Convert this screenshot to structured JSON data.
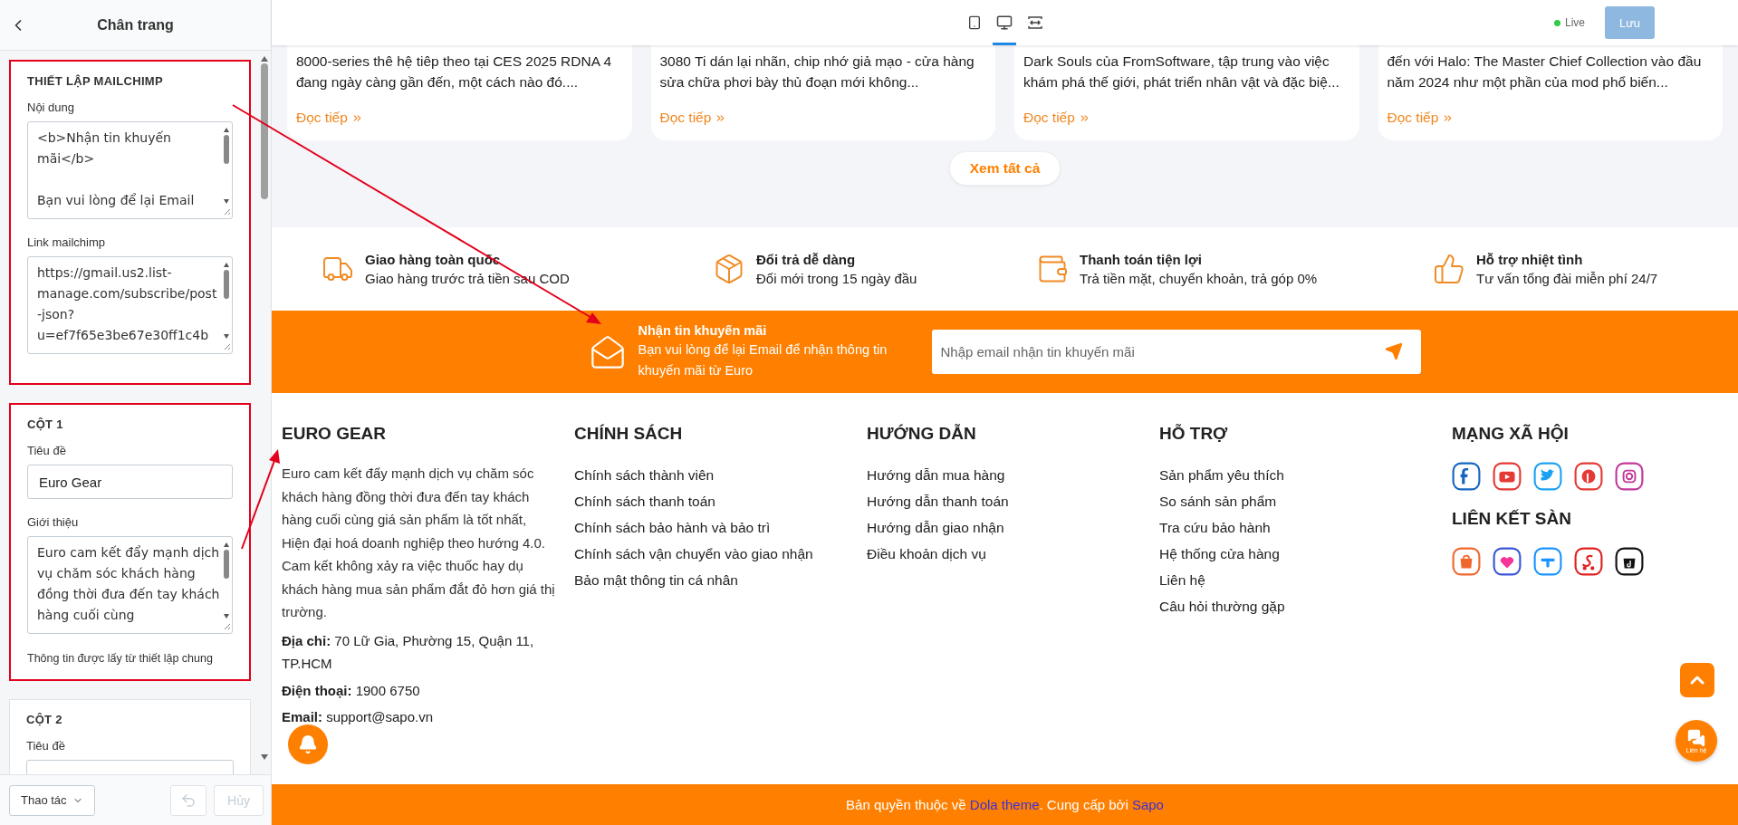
{
  "sidebar": {
    "title": "Chân trang",
    "sections": [
      {
        "heading": "THIẾT LẬP MAILCHIMP",
        "highlighted": true,
        "fields": [
          {
            "kind": "textarea",
            "label": "Nội dung",
            "value": "<b>Nhận tin khuyến mãi</b>\n\nBạn vui lòng để lại Email"
          },
          {
            "kind": "textarea",
            "label": "Link mailchimp",
            "value": "https://gmail.us2.list-manage.com/subscribe/post-json?u=ef7f65e3be67e30ff1c4b"
          }
        ]
      },
      {
        "heading": "CỘT 1",
        "highlighted": true,
        "fields": [
          {
            "kind": "input",
            "label": "Tiêu đề",
            "value": "Euro Gear"
          },
          {
            "kind": "textarea",
            "label": "Giới thiệu",
            "value": "Euro cam kết đẩy mạnh dịch vụ chăm sóc khách hàng đồng thời đưa đến tay khách hàng cuối cùng"
          }
        ],
        "note": "Thông tin được lấy từ thiết lập chung"
      },
      {
        "heading": "CỘT 2",
        "highlighted": false,
        "fields": [
          {
            "kind": "input",
            "label": "Tiêu đề"
          }
        ]
      }
    ],
    "actions_button": "Thao tác",
    "undo": {
      "disabled": true
    },
    "cancel": {
      "label": "Hủy",
      "disabled": true
    }
  },
  "toolbar": {
    "devices": [
      {
        "kind": "tablet",
        "selected": false
      },
      {
        "kind": "desktop",
        "selected": true
      },
      {
        "kind": "fullwidth",
        "selected": false
      }
    ],
    "status": "Live",
    "save": {
      "label": "Lưu",
      "disabled": true
    }
  },
  "articles": [
    {
      "excerpt": "8000-series thê hệ tiêp theo tại CES 2025 RDNA 4 đang ngày càng gần đến, một cách nào đó....",
      "link": "Đọc tiếp"
    },
    {
      "excerpt": "3080 Ti dán lại nhãn, chip nhớ giả mạo - cửa hàng sửa chữa phơi bày thủ đoạn mới không...",
      "link": "Đọc tiếp"
    },
    {
      "excerpt": "Dark Souls của FromSoftware, tập trung vào việc khám phá thế giới, phát triển nhân vật và đặc biệ...",
      "link": "Đọc tiếp"
    },
    {
      "excerpt": "đến với Halo: The Master Chief Collection vào đầu năm 2024 như một phần của mod phổ biến...",
      "link": "Đọc tiếp"
    }
  ],
  "view_all": "Xem tất cả",
  "features": [
    {
      "title": "Giao hàng toàn quốc",
      "subtitle": "Giao hàng trước trả tiền sau COD"
    },
    {
      "title": "Đổi trả dễ dàng",
      "subtitle": "Đổi mới trong 15 ngày đầu"
    },
    {
      "title": "Thanh toán tiện lợi",
      "subtitle": "Trả tiền mặt, chuyển khoản, trả góp 0%"
    },
    {
      "title": "Hỗ trợ nhiệt tình",
      "subtitle": "Tư vấn tổng đài miễn phí 24/7"
    }
  ],
  "newsletter": {
    "title": "Nhận tin khuyến mãi",
    "text": "Bạn vui lòng để lại Email để nhận thông tin khuyến mãi từ Euro",
    "placeholder": "Nhập email nhận tin khuyến mãi"
  },
  "footer_columns": [
    {
      "kind": "about",
      "heading": "EURO GEAR",
      "paragraph": "Euro cam kết đẩy mạnh dịch vụ chăm sóc khách hàng đồng thời đưa đến tay khách hàng cuối cùng giá sản phẩm là tốt nhất, Hiện đại hoá doanh nghiệp theo hướng 4.0. Cam kết không xảy ra việc thuốc hay dụ khách hàng mua sản phẩm đắt đỏ hơn giá thị trường.",
      "contacts": [
        "**Địa chỉ:** 70 Lữ Gia, Phường 15, Quận 11, TP.HCM",
        "**Điện thoại:** 1900 6750",
        "**Email:** support@sapo.vn"
      ]
    },
    {
      "kind": "links",
      "heading": "CHÍNH SÁCH",
      "links": [
        "Chính sách thành viên",
        "Chính sách thanh toán",
        "Chính sách bảo hành và bảo trì",
        "Chính sách vận chuyển vào giao nhận",
        "Bảo mật thông tin cá nhân"
      ]
    },
    {
      "kind": "links",
      "heading": "HƯỚNG DẪN",
      "links": [
        "Hướng dẫn mua hàng",
        "Hướng dẫn thanh toán",
        "Hướng dẫn giao nhận",
        "Điều khoản dịch vụ"
      ]
    },
    {
      "kind": "links",
      "heading": "HỖ TRỢ",
      "links": [
        "Sản phẩm yêu thích",
        "So sánh sản phẩm",
        "Tra cứu bảo hành",
        "Hệ thống cửa hàng",
        "Liên hệ",
        "Câu hỏi thường gặp"
      ]
    },
    {
      "kind": "social",
      "heading": "MẠNG XÃ HỘI",
      "second_heading": "LIÊN KẾT SÀN"
    }
  ],
  "chat_label": "Liên hệ",
  "copyright": [
    {
      "text": "Bản quyền thuộc về ",
      "link": false
    },
    {
      "text": "Dola theme",
      "link": true
    },
    {
      "text": ". Cung cấp bởi ",
      "link": false
    },
    {
      "text": "Sapo",
      "link": true
    }
  ]
}
